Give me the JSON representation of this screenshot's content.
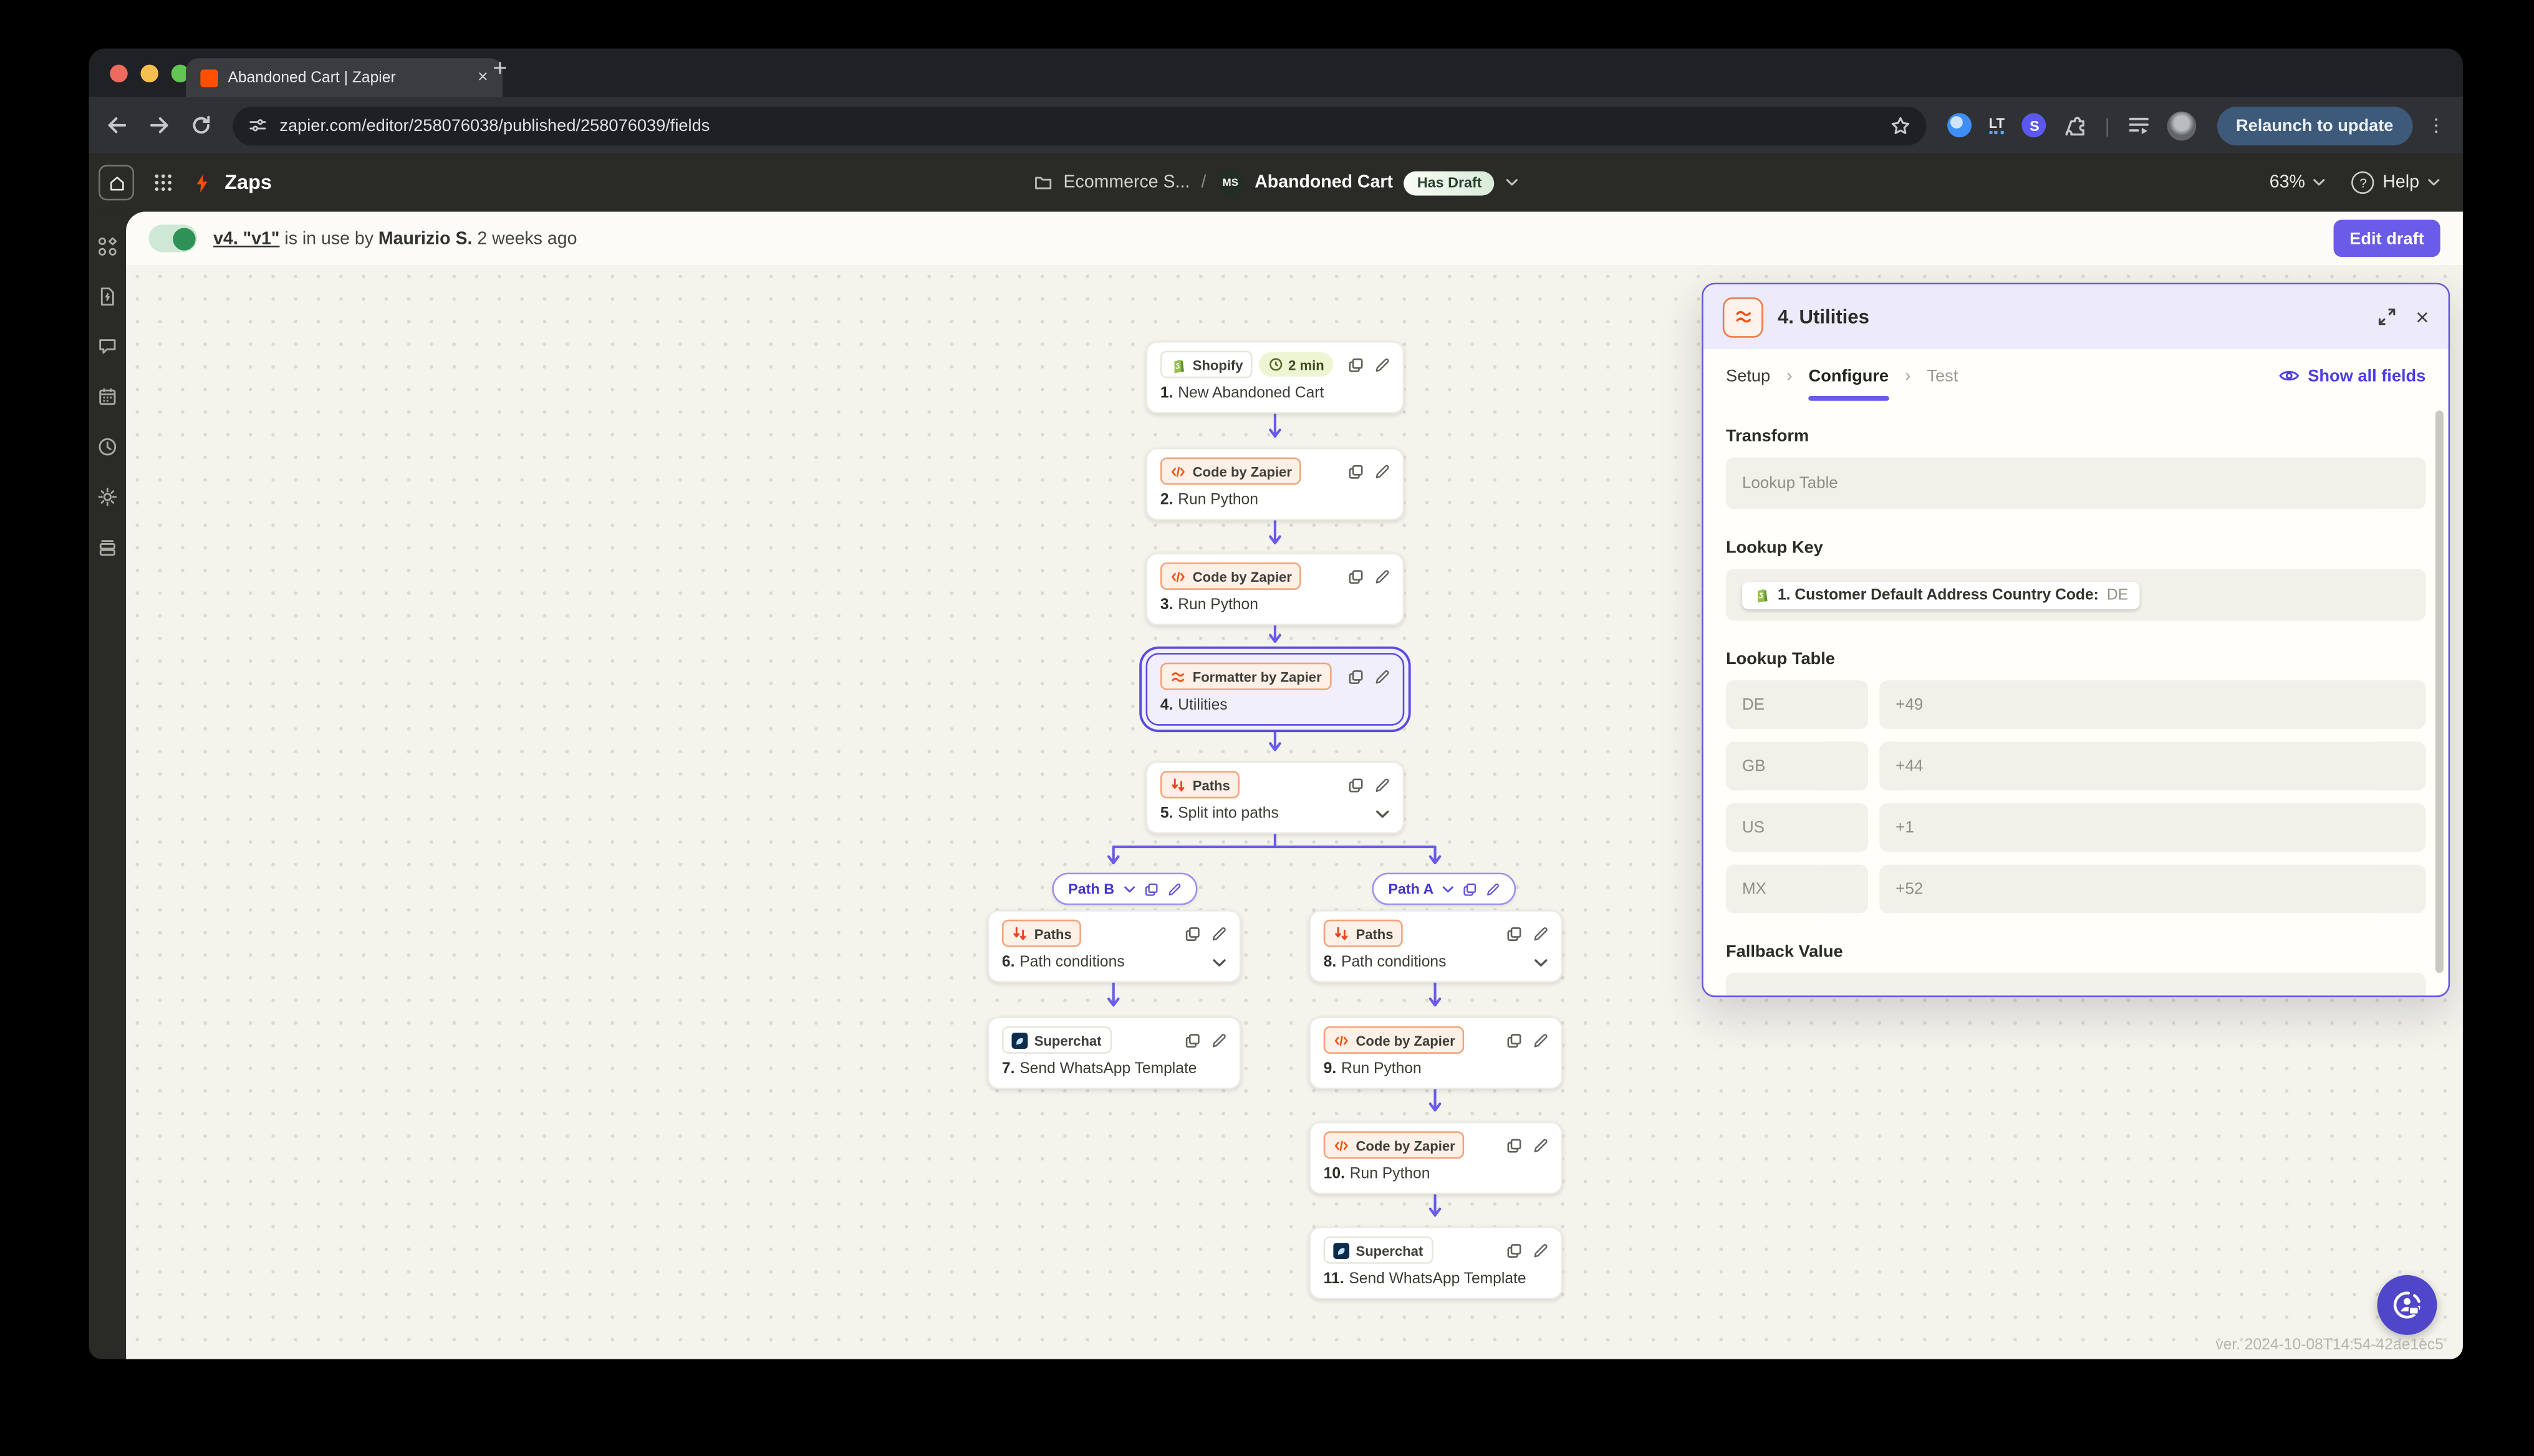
{
  "browser": {
    "tab_title": "Abandoned Cart | Zapier",
    "url": "zapier.com/editor/258076038/published/258076039/fields",
    "relaunch": "Relaunch to update"
  },
  "glyphs": {
    "close": "×",
    "plus": "+",
    "kebab": "⋮",
    "sep": "›",
    "slash": "/",
    "divider": "|",
    "question": "?"
  },
  "nav": {
    "product": "Zaps",
    "folder": "Ecommerce S...",
    "owner_initials": "MS",
    "zap_name": "Abandoned Cart",
    "draft_badge": "Has Draft",
    "zoom": "63%",
    "help": "Help"
  },
  "statusbar": {
    "version_link": "v4. \"v1\"",
    "in_use_text": "is in use by",
    "owner": "Maurizio S.",
    "ago": "2 weeks ago",
    "edit_draft": "Edit draft"
  },
  "canvas": {
    "nodes": [
      {
        "num": "1.",
        "label": "New Abandoned Cart",
        "app": "Shopify",
        "meta": "2 min"
      },
      {
        "num": "2.",
        "label": "Run Python",
        "app": "Code by Zapier"
      },
      {
        "num": "3.",
        "label": "Run Python",
        "app": "Code by Zapier"
      },
      {
        "num": "4.",
        "label": "Utilities",
        "app": "Formatter by Zapier"
      },
      {
        "num": "5.",
        "label": "Split into paths",
        "app": "Paths"
      },
      {
        "num": "6.",
        "label": "Path conditions",
        "app": "Paths"
      },
      {
        "num": "7.",
        "label": "Send WhatsApp Template",
        "app": "Superchat"
      },
      {
        "num": "8.",
        "label": "Path conditions",
        "app": "Paths"
      },
      {
        "num": "9.",
        "label": "Run Python",
        "app": "Code by Zapier"
      },
      {
        "num": "10.",
        "label": "Run Python",
        "app": "Code by Zapier"
      },
      {
        "num": "11.",
        "label": "Send WhatsApp Template",
        "app": "Superchat"
      }
    ],
    "paths": {
      "b": "Path B",
      "a": "Path A"
    },
    "version_footer": "ver. 2024-10-08T14:54-42ae1ec5"
  },
  "panel": {
    "title": "4. Utilities",
    "tabs": {
      "setup": "Setup",
      "configure": "Configure",
      "test": "Test"
    },
    "show_all_fields": "Show all fields",
    "transform_label": "Transform",
    "transform_value": "Lookup Table",
    "lookup_key_label": "Lookup Key",
    "lookup_key_token": "1. Customer Default Address Country Code:",
    "lookup_key_value": "DE",
    "lookup_table_label": "Lookup Table",
    "rows": [
      {
        "key": "DE",
        "value": "+49"
      },
      {
        "key": "GB",
        "value": "+44"
      },
      {
        "key": "US",
        "value": "+1"
      },
      {
        "key": "MX",
        "value": "+52"
      }
    ],
    "fallback_label": "Fallback Value"
  },
  "colors": {
    "accent": "#6a5be8",
    "orange": "#ff4f00",
    "toggle_green": "#2e9257",
    "relaunch_blue": "#3d5a7a",
    "support_purple": "#4f46c9",
    "draft_from": "#fafcf6",
    "draft_to": "#d8ecd9"
  }
}
